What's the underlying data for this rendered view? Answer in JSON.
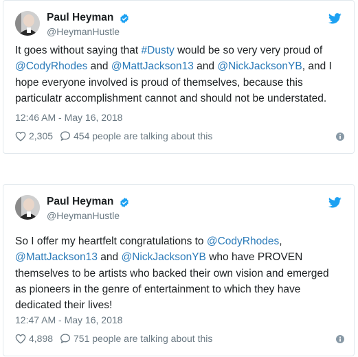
{
  "tweets": [
    {
      "author_name": "Paul Heyman",
      "author_handle": "@HeymanHustle",
      "text_lines": [
        [
          {
            "t": "It goes without saying that "
          },
          {
            "t": "#Dusty",
            "link": true
          },
          {
            "t": " would be so very very proud of"
          }
        ],
        [
          {
            "t": "@CodyRhodes",
            "link": true
          },
          {
            "t": " and "
          },
          {
            "t": "@MattJackson13",
            "link": true
          },
          {
            "t": " and "
          },
          {
            "t": "@NickJacksonYB",
            "link": true
          },
          {
            "t": ", and I"
          }
        ],
        [
          {
            "t": "hope everyone involved is proud of themselves, because this"
          }
        ],
        [
          {
            "t": "particulatr accomplishment cannot and should not be understated."
          }
        ]
      ],
      "timestamp": "12:46 AM - May 16, 2018",
      "likes": "2,305",
      "talking": "454 people are talking about this"
    },
    {
      "author_name": "Paul Heyman",
      "author_handle": "@HeymanHustle",
      "text_lines": [
        [
          {
            "t": "So I offer my heartfelt congratulations to "
          },
          {
            "t": "@CodyRhodes",
            "link": true
          },
          {
            "t": ","
          }
        ],
        [
          {
            "t": "@MattJackson13",
            "link": true
          },
          {
            "t": " and "
          },
          {
            "t": "@NickJacksonYB",
            "link": true
          },
          {
            "t": " who have PROVEN"
          }
        ],
        [
          {
            "t": "themselves to be artists who backed their own vision and emerged"
          }
        ],
        [
          {
            "t": "as pioneers in the genre of entertainment to which they have"
          }
        ],
        [
          {
            "t": "dedicated their lives!"
          }
        ]
      ],
      "timestamp": "12:47 AM - May 16, 2018",
      "likes": "4,898",
      "talking": "751 people are talking about this"
    }
  ],
  "colors": {
    "link": "#2b7bb9",
    "text": "#1c2022",
    "muted": "#697882",
    "twitter_blue": "#1da1f2",
    "border": "#e1e8ed"
  },
  "icons": {
    "verified": "verified-badge-icon",
    "bird": "twitter-bird-icon",
    "like": "heart-icon",
    "talk": "speech-bubble-icon",
    "info": "info-icon"
  }
}
